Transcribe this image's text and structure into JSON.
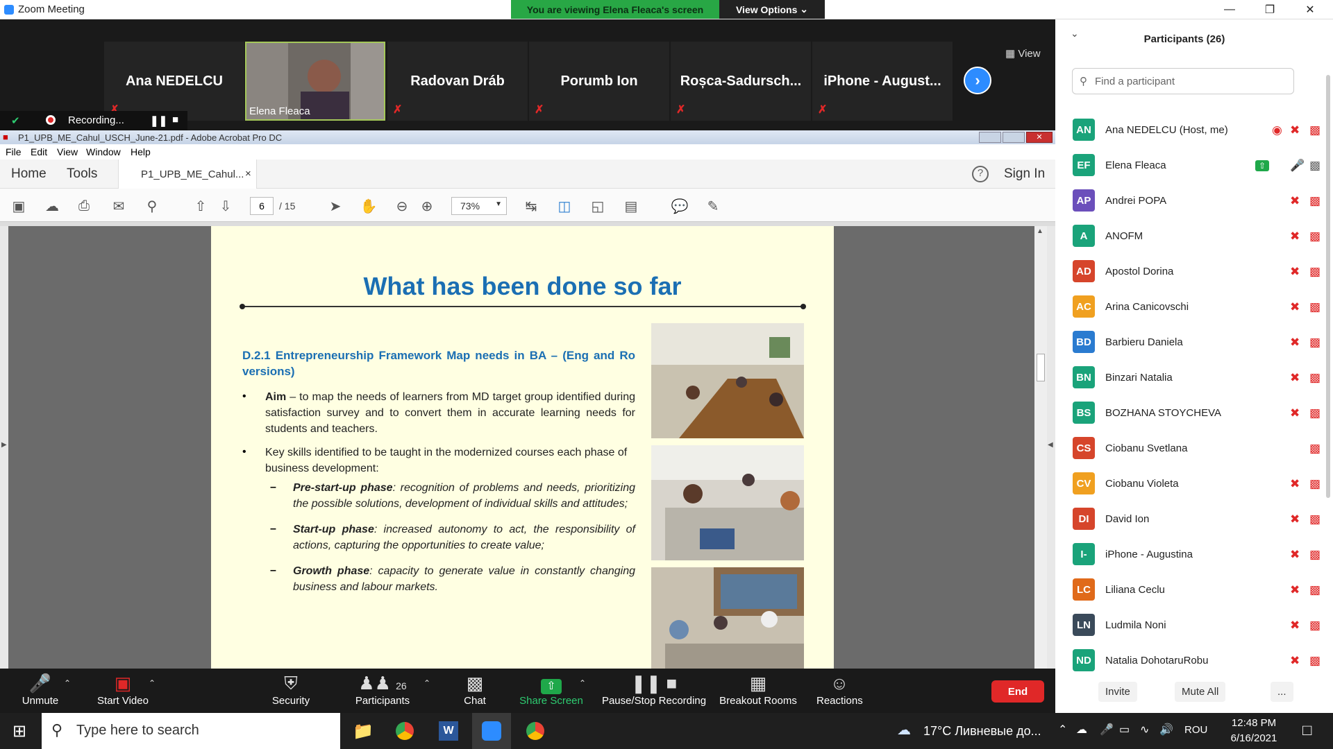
{
  "window": {
    "title": "Zoom Meeting"
  },
  "banner": {
    "viewing": "You are viewing Elena Fleaca's screen",
    "view_options": "View Options"
  },
  "thumbs": [
    {
      "name": "Ana NEDELCU"
    },
    {
      "name": "Elena Fleaca"
    },
    {
      "name": "Radovan Dráb"
    },
    {
      "name": "Porumb Ion"
    },
    {
      "name": "Roșca-Sadursch..."
    },
    {
      "name": "iPhone - August..."
    }
  ],
  "view_label": "View",
  "recording": {
    "label": "Recording..."
  },
  "acrobat": {
    "title": "P1_UPB_ME_Cahul_USCH_June-21.pdf - Adobe Acrobat Pro DC",
    "menu": [
      "File",
      "Edit",
      "View",
      "Window",
      "Help"
    ],
    "tabs": {
      "home": "Home",
      "tools": "Tools",
      "doc": "P1_UPB_ME_Cahul...",
      "signin": "Sign In"
    },
    "page_current": "6",
    "page_total": "/ 15",
    "zoom": "73%"
  },
  "slide": {
    "title": "What has been done so far",
    "subtitle": "D.2.1 Entrepreneurship Framework Map needs in BA – (Eng and Ro versions)",
    "b1_head": "Aim",
    "b1_text": " –  to map the needs of learners from MD target group identified during satisfaction survey and to convert them in accurate learning needs for students and teachers.",
    "b2_text": "Key skills identified to be taught in the modernized courses each phase of business development:",
    "s1_head": "Pre-start-up phase",
    "s1_text": ": recognition of problems and needs, prioritizing the possible solutions, development of individual skills and attitudes;",
    "s2_head": "Start-up phase",
    "s2_text": ": increased autonomy to act, the responsibility of actions, capturing the opportunities to create value;",
    "s3_head": "Growth phase",
    "s3_text": ": capacity to generate value in constantly changing business and labour markets."
  },
  "participants": {
    "header": "Participants (26)",
    "search_placeholder": "Find a participant",
    "list": [
      {
        "initials": "AN",
        "name": "Ana NEDELCU (Host, me)",
        "color": "#1aa37a"
      },
      {
        "initials": "EF",
        "name": "Elena Fleaca",
        "color": "#1aa37a"
      },
      {
        "initials": "AP",
        "name": "Andrei POPA",
        "color": "#6b4fbb"
      },
      {
        "initials": "A",
        "name": "ANOFM",
        "color": "#1aa37a"
      },
      {
        "initials": "AD",
        "name": "Apostol Dorina",
        "color": "#d6452b"
      },
      {
        "initials": "AC",
        "name": "Arina Canicovschi",
        "color": "#f0a020"
      },
      {
        "initials": "BD",
        "name": "Barbieru Daniela",
        "color": "#2a7bd0"
      },
      {
        "initials": "BN",
        "name": "Binzari Natalia",
        "color": "#1aa37a"
      },
      {
        "initials": "BS",
        "name": "BOZHANA STOYCHEVA",
        "color": "#1aa37a"
      },
      {
        "initials": "CS",
        "name": "Ciobanu Svetlana",
        "color": "#d6452b"
      },
      {
        "initials": "CV",
        "name": "Ciobanu Violeta",
        "color": "#f0a020"
      },
      {
        "initials": "DI",
        "name": "David Ion",
        "color": "#d6452b"
      },
      {
        "initials": "I-",
        "name": "iPhone - Augustina",
        "color": "#1aa37a"
      },
      {
        "initials": "LC",
        "name": "Liliana Ceclu",
        "color": "#e06a1a"
      },
      {
        "initials": "LN",
        "name": "Ludmila Noni",
        "color": "#3a4a5a"
      },
      {
        "initials": "ND",
        "name": "Natalia DohotaruRobu",
        "color": "#1aa37a"
      }
    ],
    "invite": "Invite",
    "mute_all": "Mute All",
    "more": "..."
  },
  "toolbar": {
    "unmute": "Unmute",
    "start_video": "Start Video",
    "security": "Security",
    "participants": "Participants",
    "participants_count": "26",
    "chat": "Chat",
    "share": "Share Screen",
    "pause_rec": "Pause/Stop Recording",
    "breakout": "Breakout Rooms",
    "reactions": "Reactions",
    "end": "End"
  },
  "taskbar": {
    "search": "Type here to search",
    "weather": "17°C  Ливневые до...",
    "lang": "ROU",
    "time": "12:48 PM",
    "date": "6/16/2021"
  }
}
